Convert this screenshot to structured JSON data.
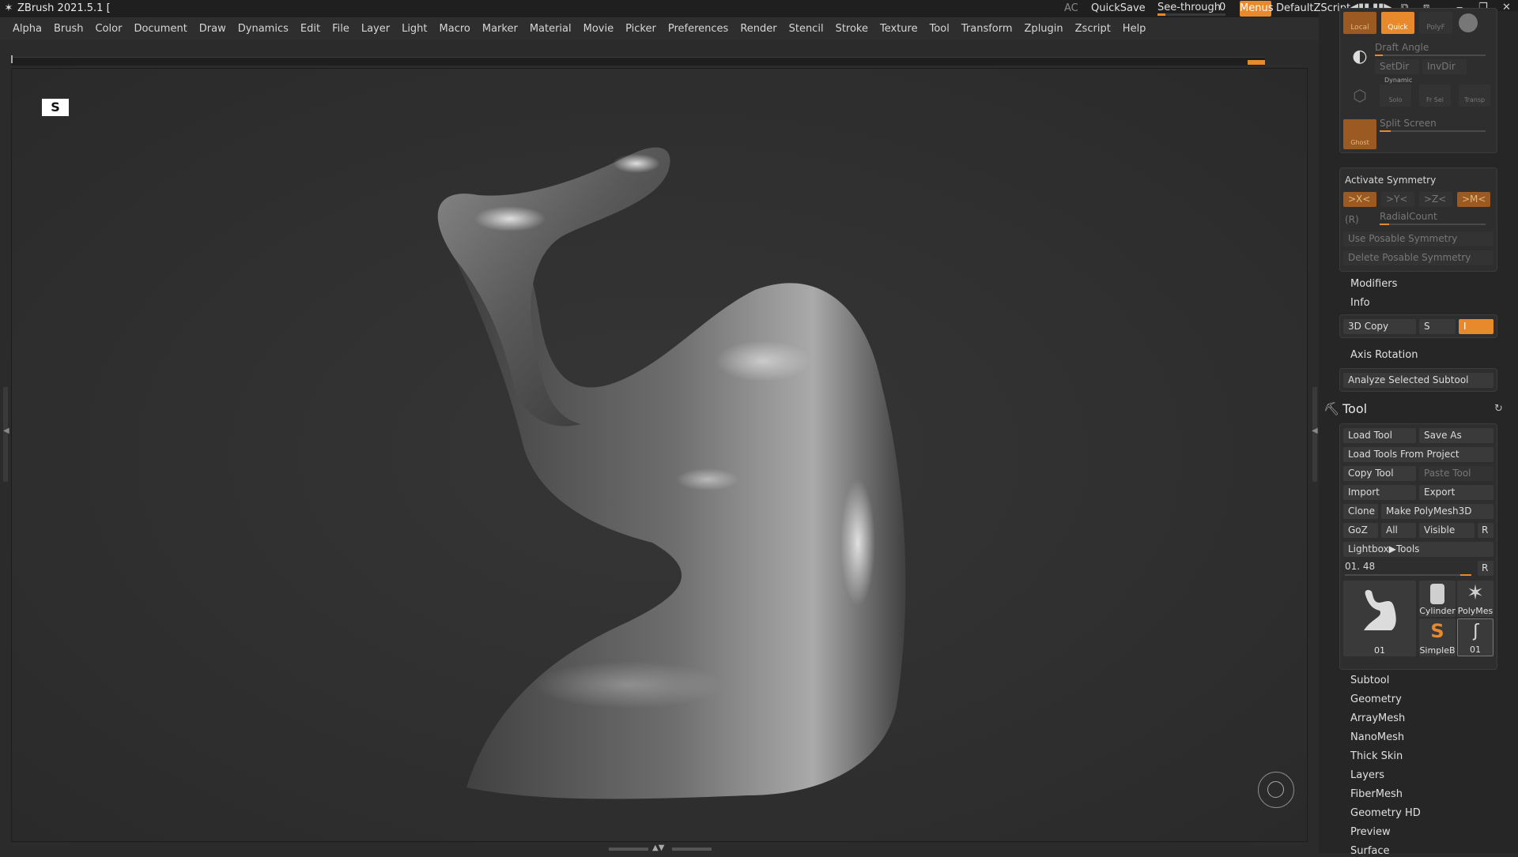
{
  "titlebar": {
    "title": "ZBrush 2021.5.1 [",
    "ac": "AC",
    "quicksave": "QuickSave",
    "seethrough_label": "See-through",
    "seethrough_value": "0",
    "seethrough_level": 0.12,
    "menus": "Menus",
    "script": "DefaultZScript"
  },
  "menubar": {
    "items": [
      "Alpha",
      "Brush",
      "Color",
      "Document",
      "Draw",
      "Dynamics",
      "Edit",
      "File",
      "Layer",
      "Light",
      "Macro",
      "Marker",
      "Material",
      "Movie",
      "Picker",
      "Preferences",
      "Render",
      "Stencil",
      "Stroke",
      "Texture",
      "Tool",
      "Transform",
      "Zplugin",
      "Zscript",
      "Help"
    ]
  },
  "canvas": {
    "logo": "S"
  },
  "panel": {
    "top_section": {
      "local": "Local",
      "quick": "Quick",
      "polyf": "PolyF",
      "draft_angle": "Draft Angle",
      "setdir": "SetDir",
      "invdir": "InvDir",
      "dynamic": "Dynamic",
      "solo": "Solo",
      "fr_sel": "Fr Sel",
      "transp": "Transp",
      "split_screen": "Split Screen",
      "ghost": "Ghost"
    },
    "symmetry": {
      "title": "Activate Symmetry",
      "x": ">X<",
      "y": ">Y<",
      "z": ">Z<",
      "m": ">M<",
      "r": "(R)",
      "radial_count": "RadialCount",
      "use_posable": "Use Posable Symmetry",
      "delete_posable": "Delete Posable Symmetry"
    },
    "modifiers": "Modifiers",
    "info": "Info",
    "copy3d": "3D Copy",
    "s_label": "S",
    "i_label": "I",
    "axis_rotation": "Axis Rotation",
    "analyze": "Analyze Selected Subtool",
    "tool": {
      "title": "Tool",
      "load_tool": "Load Tool",
      "save_as": "Save As",
      "load_from_project": "Load Tools From Project",
      "copy_tool": "Copy Tool",
      "paste_tool": "Paste Tool",
      "import": "Import",
      "export": "Export",
      "clone": "Clone",
      "make_polymesh": "Make PolyMesh3D",
      "goz": "GoZ",
      "all": "All",
      "visible": "Visible",
      "r": "R",
      "lightbox": "Lightbox▶Tools",
      "current": "01. 48",
      "current_r": "R",
      "thumb_main": "01",
      "thumb_cylinder": "Cylinder",
      "thumb_polymesh": "PolyMes",
      "thumb_simpleb": "SimpleB",
      "thumb_01": "01"
    },
    "subpalettes": [
      "Subtool",
      "Geometry",
      "ArrayMesh",
      "NanoMesh",
      "Thick Skin",
      "Layers",
      "FiberMesh",
      "Geometry HD",
      "Preview",
      "Surface"
    ]
  },
  "colors": {
    "accent": "#e8892b",
    "background": "#2b2b2b",
    "panel": "#262626"
  }
}
